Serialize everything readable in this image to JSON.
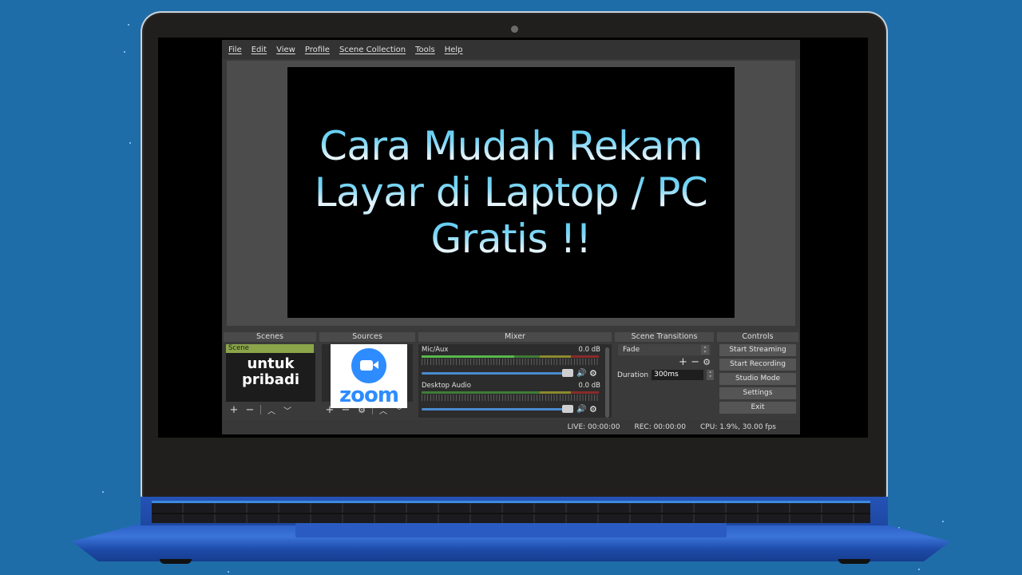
{
  "menubar": {
    "items": [
      "File",
      "Edit",
      "View",
      "Profile",
      "Scene Collection",
      "Tools",
      "Help"
    ]
  },
  "preview": {
    "lines": [
      "Cara Mudah Rekam",
      "Layar di Laptop / PC",
      "Gratis !!"
    ]
  },
  "docks": {
    "scenes": {
      "title": "Scenes",
      "items": [
        "Scene"
      ],
      "thumbnail_text": [
        "untuk",
        "pribadi"
      ],
      "toolbar_icons": [
        "plus-icon",
        "minus-icon",
        "separator",
        "chevron-up-icon",
        "chevron-down-icon"
      ]
    },
    "sources": {
      "title": "Sources",
      "thumbnail_text": "zoom",
      "toolbar_icons": [
        "plus-icon",
        "minus-icon",
        "gear-icon",
        "separator",
        "chevron-up-icon",
        "chevron-down-icon"
      ]
    },
    "mixer": {
      "title": "Mixer",
      "channels": [
        {
          "name": "Mic/Aux",
          "level": "0.0 dB",
          "volume_percent": 100
        },
        {
          "name": "Desktop Audio",
          "level": "0.0 dB",
          "volume_percent": 100
        }
      ],
      "meter_ticks": [
        "-60",
        "-55",
        "-50",
        "-45",
        "-40",
        "-35",
        "-30",
        "-25",
        "-20",
        "-15",
        "-10",
        "-5",
        "0"
      ]
    },
    "transitions": {
      "title": "Scene Transitions",
      "selected": "Fade",
      "duration_label": "Duration",
      "duration_value": "300ms"
    },
    "controls": {
      "title": "Controls",
      "buttons": [
        "Start Streaming",
        "Start Recording",
        "Studio Mode",
        "Settings",
        "Exit"
      ]
    }
  },
  "statusbar": {
    "live": "LIVE: 00:00:00",
    "rec": "REC: 00:00:00",
    "cpu": "CPU: 1.9%, 30.00 fps"
  },
  "colors": {
    "background": "#1f6da8",
    "laptop_body": "#2453b6",
    "scene_selected": "#8ba54a",
    "zoom_brand": "#2d8cff",
    "title_text_top": "#54c8f0"
  }
}
